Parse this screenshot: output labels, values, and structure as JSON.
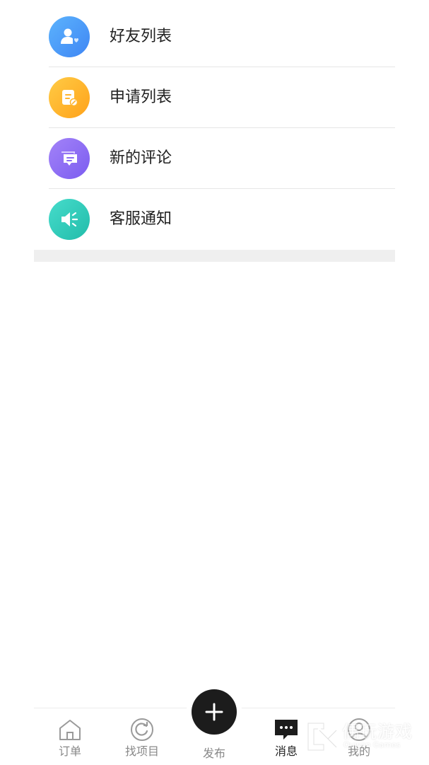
{
  "menu": {
    "items": [
      {
        "label": "好友列表",
        "icon": "friends-icon",
        "color_start": "#5aaefc",
        "color_end": "#3e8af5"
      },
      {
        "label": "申请列表",
        "icon": "application-icon",
        "color_start": "#ffc53d",
        "color_end": "#ffa41b"
      },
      {
        "label": "新的评论",
        "icon": "comment-icon",
        "color_start": "#9c7cf7",
        "color_end": "#7c5cf0"
      },
      {
        "label": "客服通知",
        "icon": "speaker-icon",
        "color_start": "#3fd6c6",
        "color_end": "#26bfae"
      }
    ]
  },
  "tabbar": {
    "tabs": [
      {
        "label": "订单",
        "icon": "home-icon",
        "active": false
      },
      {
        "label": "找项目",
        "icon": "refresh-circle-icon",
        "active": false
      },
      {
        "label": "发布",
        "icon": "plus-icon",
        "active": false
      },
      {
        "label": "消息",
        "icon": "chat-icon",
        "active": true
      },
      {
        "label": "我的",
        "icon": "user-circle-icon",
        "active": false
      }
    ]
  },
  "watermark": {
    "title": "偶玩游戏",
    "subtitle": "Ouwan Games"
  }
}
